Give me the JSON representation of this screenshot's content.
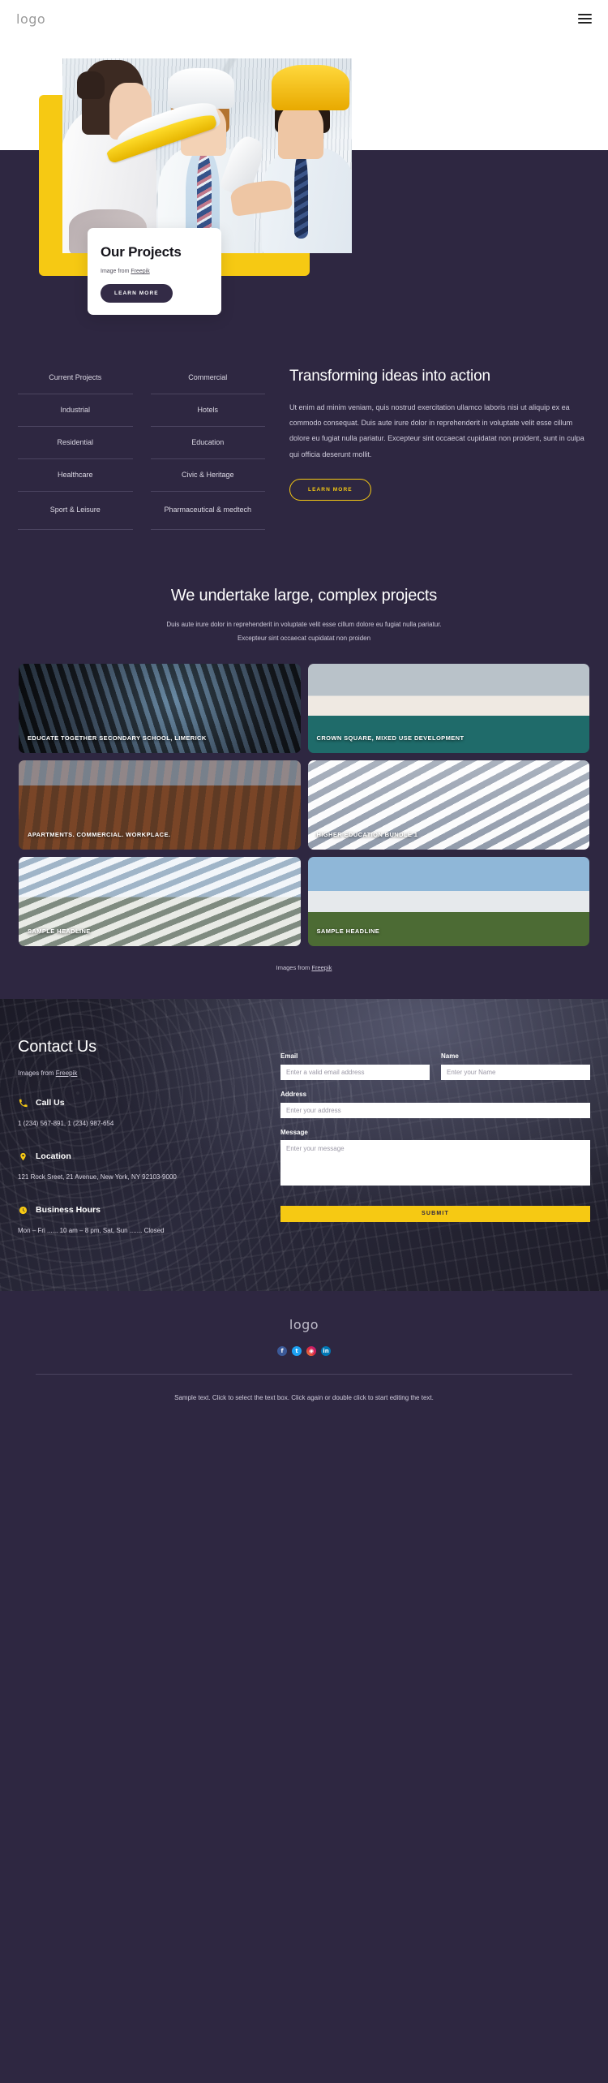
{
  "header": {
    "logo": "logo",
    "menu_icon": "hamburger-icon"
  },
  "hero": {
    "title": "Our Projects",
    "credit_prefix": "Image from ",
    "credit_link": "Freepik",
    "cta": "LEARN MORE"
  },
  "categories": [
    {
      "label": "Current Projects"
    },
    {
      "label": "Commercial"
    },
    {
      "label": "Industrial"
    },
    {
      "label": "Hotels"
    },
    {
      "label": "Residential"
    },
    {
      "label": "Education"
    },
    {
      "label": "Healthcare"
    },
    {
      "label": "Civic & Heritage"
    },
    {
      "label": "Sport & Leisure"
    },
    {
      "label": "Pharmaceutical & medtech"
    }
  ],
  "intro": {
    "heading": "Transforming ideas into action",
    "body": "Ut enim ad minim veniam, quis nostrud exercitation ullamco laboris nisi ut aliquip ex ea commodo consequat. Duis aute irure dolor in reprehenderit in voluptate velit esse cillum dolore eu fugiat nulla pariatur. Excepteur sint occaecat cupidatat non proident, sunt in culpa qui officia deserunt mollit.",
    "cta": "LEARN MORE"
  },
  "gallery": {
    "heading": "We undertake large, complex projects",
    "sub_line1": "Duis aute irure dolor in reprehenderit in voluptate velit esse cillum dolore eu fugiat nulla pariatur.",
    "sub_line2": "Excepteur sint occaecat cupidatat non proiden",
    "tiles": [
      {
        "caption": "EDUCATE TOGETHER SECONDARY SCHOOL, LIMERICK"
      },
      {
        "caption": "CROWN SQUARE, MIXED USE DEVELOPMENT"
      },
      {
        "caption": "APARTMENTS. COMMERCIAL. WORKPLACE."
      },
      {
        "caption": "HIGHER EDUCATION BUNDLE 1"
      },
      {
        "caption": "SAMPLE HEADLINE"
      },
      {
        "caption": "SAMPLE HEADLINE"
      }
    ],
    "credit_prefix": "Images from ",
    "credit_link": "Freepik"
  },
  "contact": {
    "heading": "Contact Us",
    "credit_prefix": "Images from ",
    "credit_link": "Freepik",
    "call": {
      "icon": "phone-icon",
      "title": "Call Us",
      "text": "1 (234) 567-891, 1 (234) 987-654"
    },
    "location": {
      "icon": "map-pin-icon",
      "title": "Location",
      "text": "121 Rock Sreet, 21 Avenue, New York, NY 92103-9000"
    },
    "hours": {
      "icon": "clock-icon",
      "title": "Business Hours",
      "text": "Mon – Fri ...... 10 am – 8 pm, Sat, Sun ....... Closed"
    },
    "form": {
      "email_label": "Email",
      "email_placeholder": "Enter a valid email address",
      "name_label": "Name",
      "name_placeholder": "Enter your Name",
      "address_label": "Address",
      "address_placeholder": "Enter your address",
      "message_label": "Message",
      "message_placeholder": "Enter your message",
      "submit": "SUBMIT"
    }
  },
  "footer": {
    "logo": "logo",
    "socials": [
      {
        "name": "facebook",
        "glyph": "f"
      },
      {
        "name": "twitter",
        "glyph": "t"
      },
      {
        "name": "instagram",
        "glyph": "◉"
      },
      {
        "name": "linkedin",
        "glyph": "in"
      }
    ],
    "note": "Sample text. Click to select the text box. Click again or double click to start editing the text."
  },
  "colors": {
    "bg": "#2e2741",
    "accent": "#f6c913",
    "dark": "#332b46"
  }
}
